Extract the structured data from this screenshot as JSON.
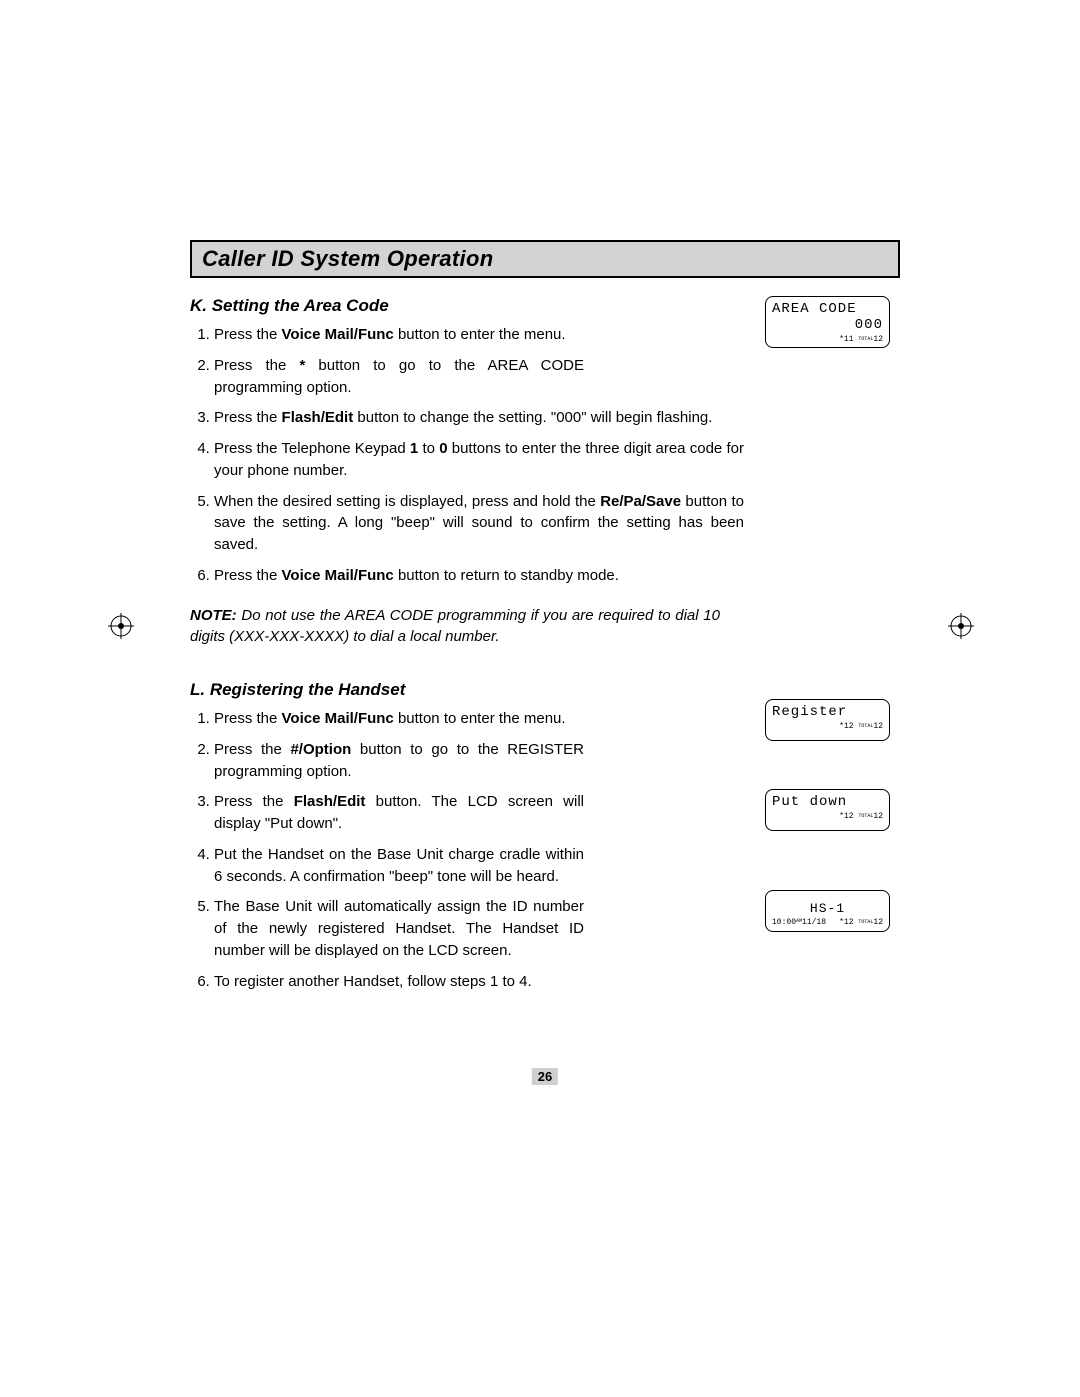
{
  "sectionTitle": "Caller ID System Operation",
  "pageNumber": "26",
  "subK": {
    "heading": "K.  Setting the Area Code",
    "steps": [
      {
        "pre": "Press the ",
        "b1": "Voice Mail/Func",
        "mid1": " button to enter the menu."
      },
      {
        "pre": "Press the   ",
        "b1": "*",
        "mid1": "   button to go to the AREA CODE programming option."
      },
      {
        "pre": "Press the   ",
        "b1": "Flash/Edit",
        "mid1": "   button to change the setting. \"000\" will begin flashing."
      },
      {
        "pre": "Press the Telephone Keypad ",
        "b1": "1",
        "mid1": " to ",
        "b2": "0",
        "mid2": " buttons to enter the three digit area code for your phone number."
      },
      {
        "pre": "When the desired setting is displayed, press and hold the  ",
        "b1": "Re/Pa/Save",
        "mid1": " button to save the setting. A long \"beep\" will sound to confirm the setting has been saved."
      },
      {
        "pre": "Press the  ",
        "b1": "Voice Mail/Func",
        "mid1": "  button to return to ",
        "tail": "standby",
        "post": " mode."
      }
    ],
    "noteLabel": "NOTE:",
    "noteText": "  Do not use the AREA CODE programming if you are required to dial 10 digits (XXX-XXX-XXXX) to dial a local number."
  },
  "subL": {
    "heading": "L.  Registering the Handset",
    "steps": [
      {
        "pre": "Press the ",
        "b1": "Voice Mail/Func",
        "mid1": " button to enter the menu."
      },
      {
        "pre": "Press the ",
        "b1": "#/Option",
        "mid1": " button to go to the REGISTER programming option."
      },
      {
        "pre": "Press the ",
        "b1": "Flash/Edit",
        "mid1": " button. The LCD screen will display \"Put down\"."
      },
      {
        "pre": "Put the Handset on the Base Unit charge cradle within 6 seconds. A confirmation \"beep\" tone will be heard."
      },
      {
        "pre": "The Base Unit will automatically assign the ID number of the newly registered Handset. The Handset ID number will be displayed on the LCD screen."
      },
      {
        "pre": "To register another Handset, follow steps 1 to 4."
      }
    ]
  },
  "lcd1": {
    "line1": "AREA CODE",
    "line2": "000",
    "bottom_star": "*11",
    "bottom_total_lbl": "TOTAL",
    "bottom_total_val": "12"
  },
  "lcd2": {
    "line1": "Register",
    "bottom_star": "*12",
    "bottom_total_lbl": "TOTAL",
    "bottom_total_val": "12"
  },
  "lcd3": {
    "line1": "Put down",
    "bottom_star": "*12",
    "bottom_total_lbl": "TOTAL",
    "bottom_total_val": "12"
  },
  "lcd4": {
    "center": "HS-1",
    "bottom_left_time": "10:00",
    "bottom_left_ampm": "AM",
    "bottom_left_date": "11/18",
    "bottom_star": "*12",
    "bottom_total_lbl": "TOTAL",
    "bottom_total_val": "12"
  }
}
